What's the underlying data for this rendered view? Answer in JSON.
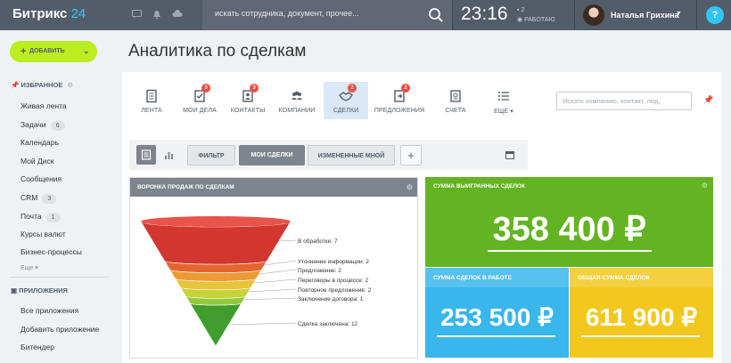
{
  "topbar": {
    "logo_text": "Битрикс",
    "logo_num": "24",
    "search_placeholder": "искать сотрудника, документ, прочее...",
    "time": "23:16",
    "notif_count": "2",
    "status": "РАБОТАЮ",
    "user_name": "Наталья Грихина",
    "help": "?"
  },
  "sidebar": {
    "add_button": "ДОБАВИТЬ",
    "favorites_title": "ИЗБРАННОЕ",
    "items": [
      {
        "label": "Живая лента",
        "count": ""
      },
      {
        "label": "Задачи",
        "count": "6"
      },
      {
        "label": "Календарь",
        "count": ""
      },
      {
        "label": "Мой Диск",
        "count": ""
      },
      {
        "label": "Сообщения",
        "count": ""
      },
      {
        "label": "CRM",
        "count": "3"
      },
      {
        "label": "Почта",
        "count": "1"
      },
      {
        "label": "Курсы валют",
        "count": ""
      },
      {
        "label": "Бизнес-процессы",
        "count": ""
      }
    ],
    "more": "Еще ▾",
    "apps_title": "ПРИЛОЖЕНИЯ",
    "apps": [
      "Все приложения",
      "Добавить приложение",
      "Битендер"
    ]
  },
  "page": {
    "title": "Аналитика по сделкам"
  },
  "crm_nav": [
    {
      "label": "ЛЕНТА",
      "icon": "feed-icon",
      "badge": ""
    },
    {
      "label": "МОИ ДЕЛА",
      "icon": "tasks-icon",
      "badge": "3"
    },
    {
      "label": "КОНТАКТЫ",
      "icon": "contacts-icon",
      "badge": "3"
    },
    {
      "label": "КОМПАНИИ",
      "icon": "companies-icon",
      "badge": ""
    },
    {
      "label": "СДЕЛКИ",
      "icon": "handshake-icon",
      "badge": "2"
    },
    {
      "label": "ПРЕДЛОЖЕНИЯ",
      "icon": "quotes-icon",
      "badge": "2"
    },
    {
      "label": "СЧЕТА",
      "icon": "invoices-icon",
      "badge": ""
    },
    {
      "label": "ЕЩЕ ▾",
      "icon": "list-icon",
      "badge": ""
    }
  ],
  "crm_search_placeholder": "Искать компанию, контакт, лид,",
  "filters": {
    "filter": "ФИЛЬТР",
    "my_deals": "МОИ СДЕЛКИ",
    "changed_by_me": "ИЗМЕНЕННЫЕ МНОЙ",
    "add": "+"
  },
  "funnel": {
    "title": "ВОРОНКА ПРОДАЖ ПО СДЕЛКАМ",
    "stages": [
      {
        "label": "В обработке: 7",
        "count": 7,
        "color": "#d2372f"
      },
      {
        "label": "Уточнение информации: 2",
        "count": 2,
        "color": "#e5652f"
      },
      {
        "label": "Предложение: 2",
        "count": 2,
        "color": "#ec9a36"
      },
      {
        "label": "Переговоры в процессе: 2",
        "count": 2,
        "color": "#e8c43a"
      },
      {
        "label": "Повторное предложение: 2",
        "count": 2,
        "color": "#c4d43a"
      },
      {
        "label": "Заключение договора: 1",
        "count": 1,
        "color": "#94c83e"
      },
      {
        "label": "Сделка заключена: 12",
        "count": 12,
        "color": "#3f9e2c"
      }
    ]
  },
  "stats": {
    "won": {
      "title": "СУММА ВЫИГРАННЫХ СДЕЛОК",
      "value": "358 400 ₽",
      "color": "#62b422"
    },
    "in_progress": {
      "title": "СУММА СДЕЛОК В РАБОТЕ",
      "value": "253 500 ₽",
      "color": "#39b6ec"
    },
    "total": {
      "title": "ОБЩАЯ СУММА СДЕЛОК",
      "value": "611 900 ₽",
      "color": "#f2c81f"
    }
  }
}
